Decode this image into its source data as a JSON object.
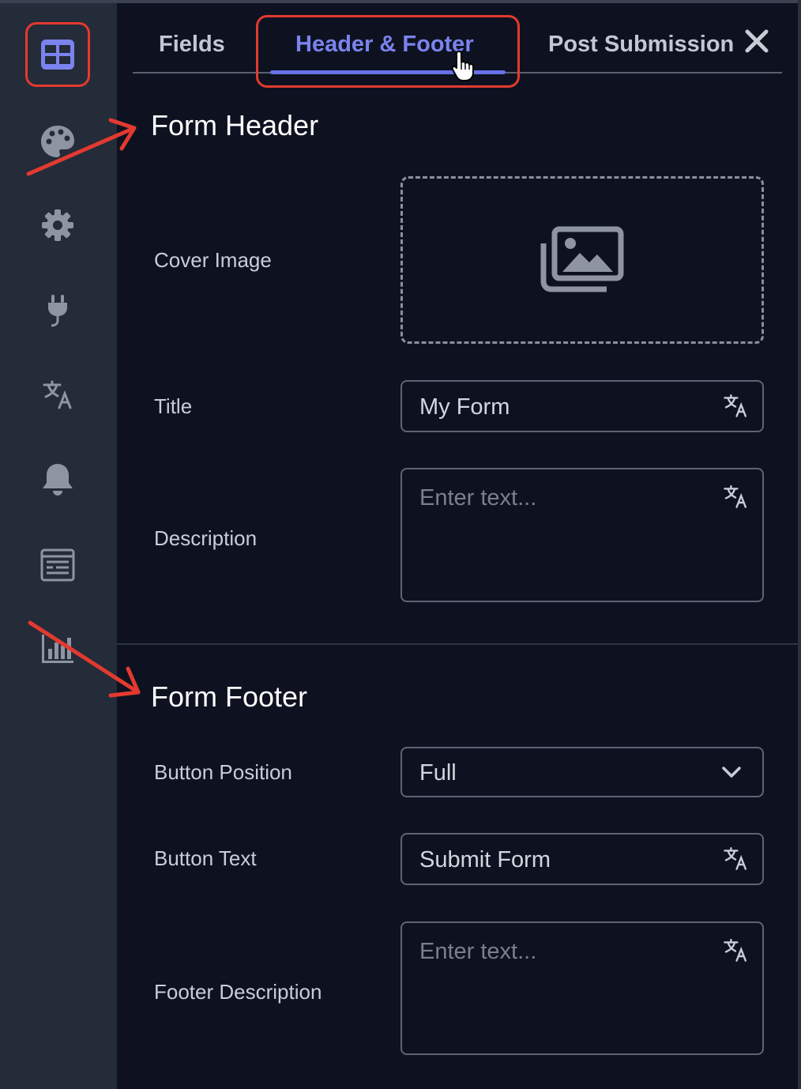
{
  "sidebar": {
    "items": [
      {
        "icon": "table-layout-icon",
        "active": true
      },
      {
        "icon": "palette-icon"
      },
      {
        "icon": "gear-icon"
      },
      {
        "icon": "plug-icon"
      },
      {
        "icon": "translate-icon"
      },
      {
        "icon": "bell-icon"
      },
      {
        "icon": "form-list-icon"
      },
      {
        "icon": "bar-chart-icon"
      }
    ]
  },
  "tabs": [
    {
      "label": "Fields"
    },
    {
      "label": "Header & Footer",
      "active": true
    },
    {
      "label": "Post Submission"
    }
  ],
  "header_section": {
    "title": "Form Header",
    "cover_image_label": "Cover Image",
    "title_label": "Title",
    "title_value": "My Form",
    "description_label": "Description",
    "description_placeholder": "Enter text..."
  },
  "footer_section": {
    "title": "Form Footer",
    "button_position_label": "Button Position",
    "button_position_value": "Full",
    "button_text_label": "Button Text",
    "button_text_value": "Submit Form",
    "footer_description_label": "Footer Description",
    "footer_description_placeholder": "Enter text..."
  },
  "colors": {
    "accent": "#7b83ef",
    "highlight": "#e23a30",
    "panel_bg": "#0e1220",
    "sidebar_bg": "#242b39"
  }
}
